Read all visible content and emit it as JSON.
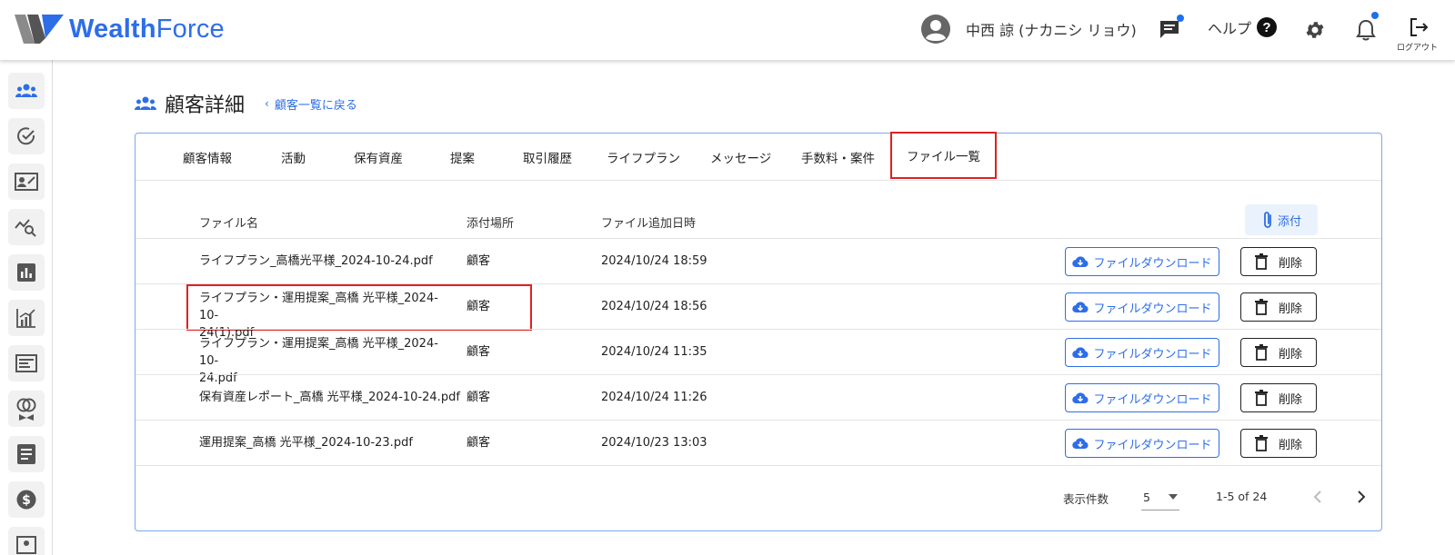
{
  "header": {
    "logo_word_1": "Wealth",
    "logo_word_2": "Force",
    "user_name": "中西 諒 (ナカニシ リョウ)",
    "help_label": "ヘルプ",
    "help_glyph": "?",
    "logout_label": "ログアウト"
  },
  "sidebar": {
    "items": [
      "customers-icon",
      "check-circle-icon",
      "id-card-icon",
      "chart-search-icon",
      "bar-chart-icon",
      "growth-chart-icon",
      "newspaper-icon",
      "rings-icon",
      "document-icon",
      "dollar-icon",
      "image-icon"
    ]
  },
  "page": {
    "title": "顧客詳細",
    "back_link": "顧客一覧に戻る"
  },
  "tabs": [
    "顧客情報",
    "活動",
    "保有資産",
    "提案",
    "取引履歴",
    "ライフプラン",
    "メッセージ",
    "手数料・案件",
    "ファイル一覧"
  ],
  "active_tab": "ファイル一覧",
  "table": {
    "headers": {
      "name": "ファイル名",
      "location": "添付場所",
      "date": "ファイル追加日時"
    },
    "attach_label": "添付",
    "download_label": "ファイルダウンロード",
    "delete_label": "削除",
    "rows": [
      {
        "name_1": "ライフプラン_高橋光平様_2024-10-24.pdf",
        "name_2": "",
        "location": "顧客",
        "date": "2024/10/24 18:59"
      },
      {
        "name_1": "ライフプラン・運用提案_高橋 光平様_2024-10-",
        "name_2": "24(1).pdf",
        "location": "顧客",
        "date": "2024/10/24 18:56"
      },
      {
        "name_1": "ライフプラン・運用提案_高橋 光平様_2024-10-",
        "name_2": "24.pdf",
        "location": "顧客",
        "date": "2024/10/24 11:35"
      },
      {
        "name_1": "保有資産レポート_高橋 光平様_2024-10-24.pdf",
        "name_2": "",
        "location": "顧客",
        "date": "2024/10/24 11:26"
      },
      {
        "name_1": "運用提案_高橋 光平様_2024-10-23.pdf",
        "name_2": "",
        "location": "顧客",
        "date": "2024/10/23 13:03"
      }
    ]
  },
  "pagination": {
    "per_page_label": "表示件数",
    "per_page_value": "5",
    "range": "1-5 of 24"
  },
  "colors": {
    "brand": "#2d6ee8",
    "highlight": "#e02020",
    "notification_dot": "#1e6ef0"
  }
}
